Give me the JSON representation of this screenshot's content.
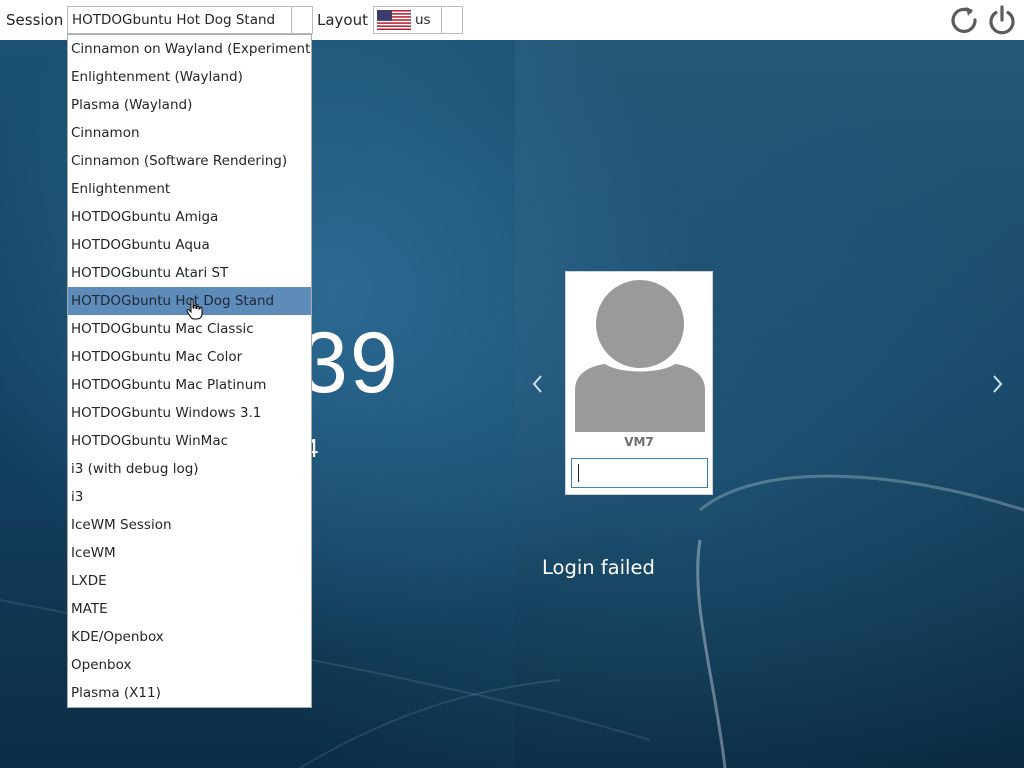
{
  "topbar": {
    "session_label": "Session",
    "session_value": "HOTDOGbuntu Hot Dog Stand",
    "layout_label": "Layout",
    "layout_value": "us",
    "layout_flag_icon": "us-flag-icon",
    "reboot_icon": "reboot-icon",
    "power_icon": "power-icon"
  },
  "session_dropdown": {
    "selected_index": 9,
    "items": [
      "Cinnamon on Wayland (Experimental)",
      "Enlightenment (Wayland)",
      "Plasma (Wayland)",
      "Cinnamon",
      "Cinnamon (Software Rendering)",
      "Enlightenment",
      "HOTDOGbuntu Amiga",
      "HOTDOGbuntu Aqua",
      "HOTDOGbuntu Atari ST",
      "HOTDOGbuntu Hot Dog Stand",
      "HOTDOGbuntu Mac Classic",
      "HOTDOGbuntu Mac Color",
      "HOTDOGbuntu Mac Platinum",
      "HOTDOGbuntu Windows 3.1",
      "HOTDOGbuntu WinMac",
      "i3 (with debug log)",
      "i3",
      "IceWM Session",
      "IceWM",
      "LXDE",
      "MATE",
      "KDE/Openbox",
      "Openbox",
      "Plasma (X11)"
    ]
  },
  "clock": {
    "time_visible": "39",
    "date_visible": "4"
  },
  "user_card": {
    "username": "VM7",
    "password_value": ""
  },
  "login_status": "Login failed",
  "colors": {
    "selection": "#5d8bba",
    "focus_border": "#3c7fbf",
    "avatar_gray": "#9a9a9a"
  }
}
